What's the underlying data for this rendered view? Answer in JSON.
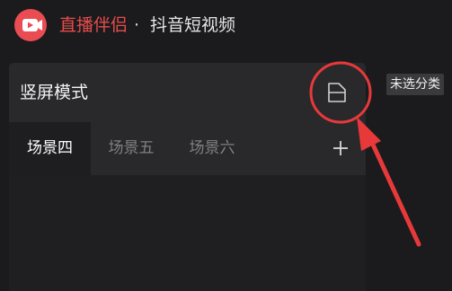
{
  "app": {
    "name": "直播伴侣",
    "separator": "·",
    "subtitle": "抖音短视频",
    "brand_color": "#e94c53"
  },
  "panel": {
    "title": "竖屏模式",
    "layout_button_icon": "layout-icon"
  },
  "scene_tabs": [
    {
      "label": "场景四",
      "active": true
    },
    {
      "label": "场景五",
      "active": false
    },
    {
      "label": "场景六",
      "active": false
    }
  ],
  "add_scene_icon": "plus-icon",
  "side_tag": {
    "label": "未选分类"
  },
  "annotation": {
    "color": "#e8393a",
    "shapes": [
      "circle",
      "arrow"
    ]
  }
}
